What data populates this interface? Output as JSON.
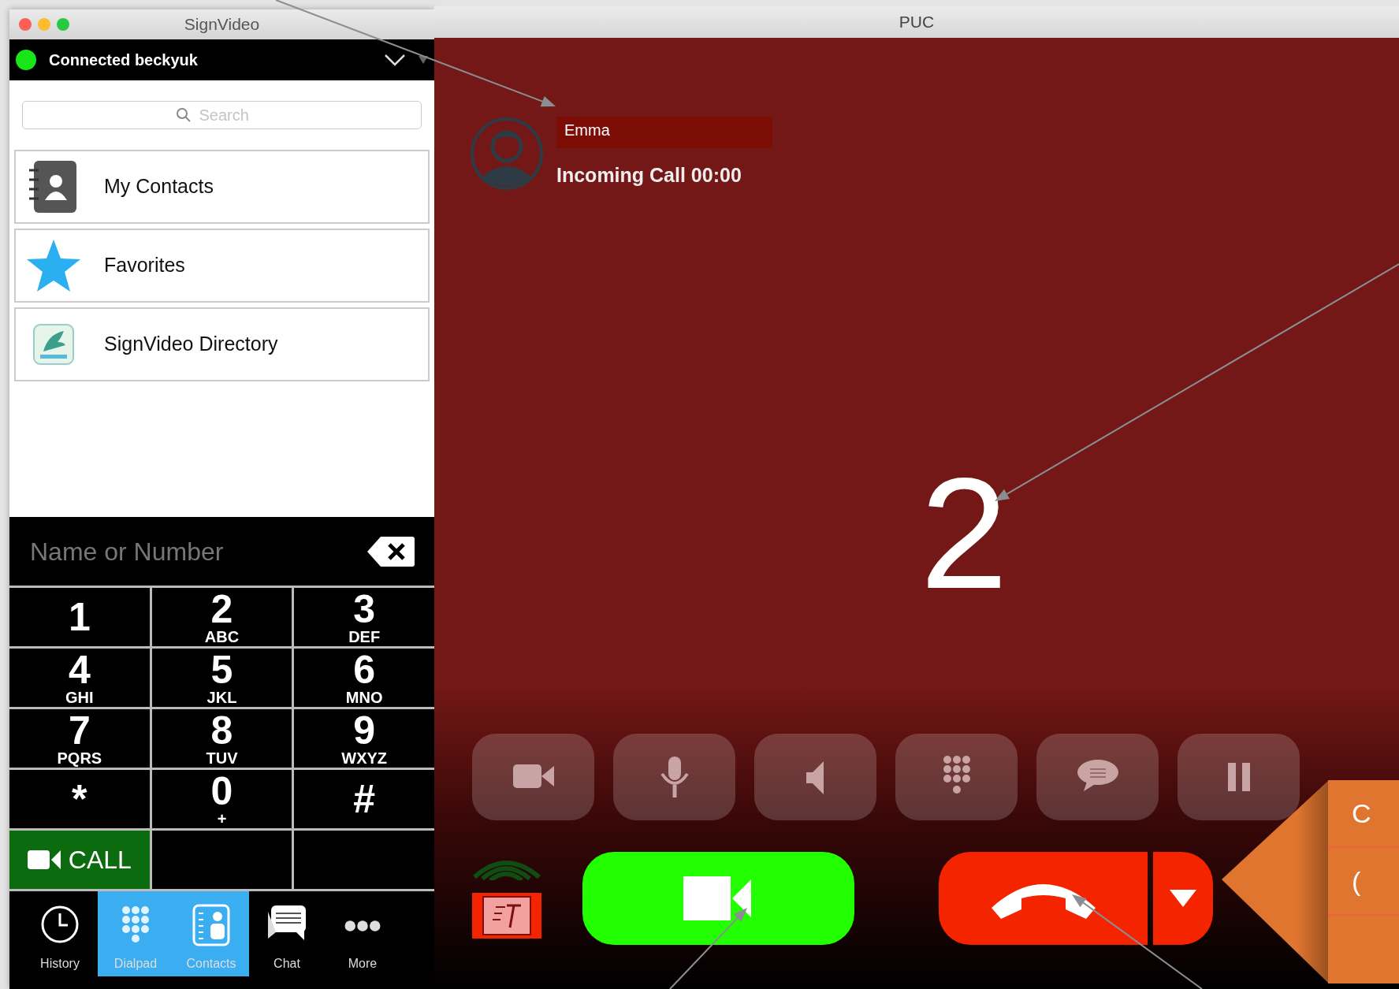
{
  "left_window": {
    "title": "SignVideo",
    "status": {
      "text": "Connected beckyuk",
      "connected": true
    },
    "search": {
      "placeholder": "Search"
    },
    "contact_groups": [
      {
        "label": "My Contacts",
        "kind": "address-book"
      },
      {
        "label": "Favorites",
        "kind": "star"
      },
      {
        "label": "SignVideo Directory",
        "kind": "directory"
      }
    ],
    "dial_entry": {
      "placeholder": "Name or Number"
    },
    "keys": [
      {
        "digit": "1"
      },
      {
        "digit": "2",
        "letters": "ABC"
      },
      {
        "digit": "3",
        "letters": "DEF"
      },
      {
        "digit": "4",
        "letters": "GHI"
      },
      {
        "digit": "5",
        "letters": "JKL"
      },
      {
        "digit": "6",
        "letters": "MNO"
      },
      {
        "digit": "7",
        "letters": "PQRS"
      },
      {
        "digit": "8",
        "letters": "TUV"
      },
      {
        "digit": "9",
        "letters": "WXYZ"
      },
      {
        "digit": "*"
      },
      {
        "digit": "0",
        "letters": "+"
      },
      {
        "digit": "#"
      }
    ],
    "call_button": "CALL",
    "tabs": [
      {
        "label": "History",
        "kind": "history",
        "selected": false
      },
      {
        "label": "Dialpad",
        "kind": "dialpad",
        "selected": true
      },
      {
        "label": "Contacts",
        "kind": "contacts",
        "selected": true
      },
      {
        "label": "Chat",
        "kind": "chat",
        "selected": false
      },
      {
        "label": "More",
        "kind": "more",
        "selected": false
      }
    ]
  },
  "call_window": {
    "title": "PUC",
    "caller": "Emma",
    "status": "Incoming Call 00:00",
    "countdown": "2",
    "callout": {
      "items": [
        "C",
        "("
      ]
    }
  }
}
